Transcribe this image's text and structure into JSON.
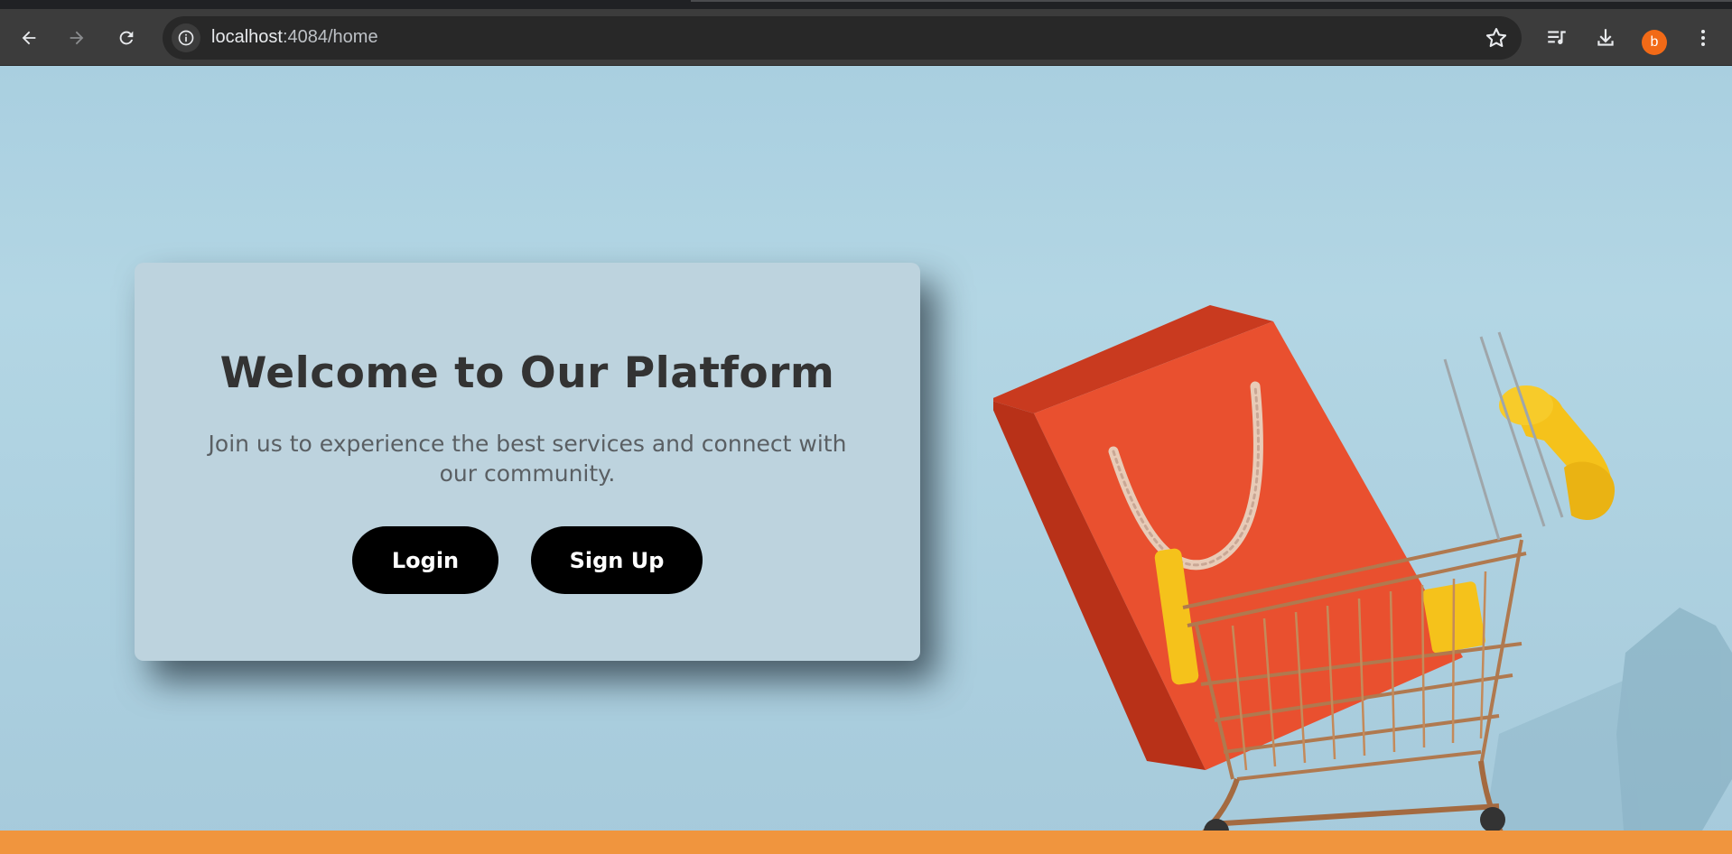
{
  "browser": {
    "url_host": "localhost",
    "url_rest": ":4084/home",
    "profile_initial": "b",
    "icons": [
      "back-arrow-icon",
      "forward-arrow-icon",
      "reload-icon",
      "site-info-icon",
      "bookmark-star-icon",
      "media-queue-icon",
      "download-icon",
      "profile-avatar",
      "more-vert-icon"
    ]
  },
  "hero": {
    "title": "Welcome to Our Platform",
    "subtitle": "Join us to experience the best services and connect with our community.",
    "login_label": "Login",
    "signup_label": "Sign Up"
  },
  "colors": {
    "page_background": "#aed0de",
    "card_background": "#bdd3de",
    "button": "#000000",
    "bag": "#e9502f",
    "cart_handle": "#f5c21b",
    "floor": "#f0953e",
    "avatar": "#f26a17"
  }
}
